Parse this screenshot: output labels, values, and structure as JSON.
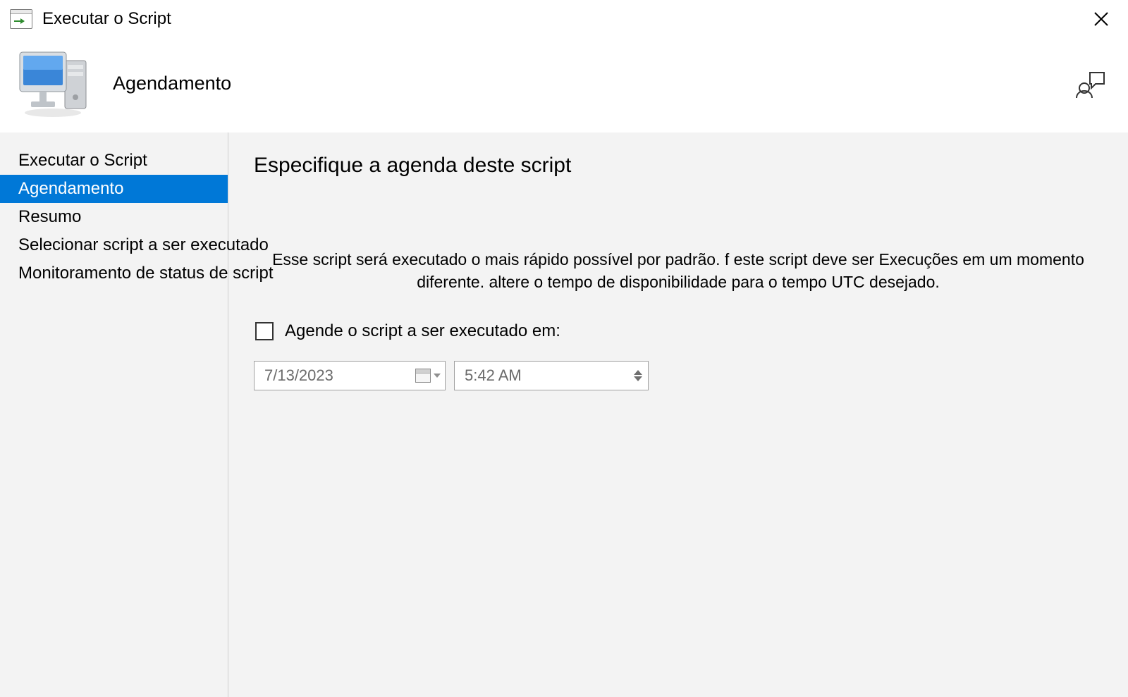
{
  "window": {
    "title": "Executar o Script"
  },
  "header": {
    "page_title": "Agendamento"
  },
  "sidebar": {
    "items": [
      {
        "label": "Executar o Script",
        "selected": false
      },
      {
        "label": "Agendamento",
        "selected": true
      },
      {
        "label": "Resumo",
        "selected": false
      },
      {
        "label": "Selecionar script a ser executado",
        "selected": false
      },
      {
        "label": "Monitoramento de status de script",
        "selected": false
      }
    ]
  },
  "content": {
    "heading": "Especifique a agenda deste script",
    "description": "Esse script será executado o mais rápido possível por padrão. f este script deve ser Execuções em um momento diferente. altere o tempo de disponibilidade para o tempo UTC desejado.",
    "checkbox_label": "Agende o script a ser executado em:",
    "checkbox_checked": false,
    "date_value": "7/13/2023",
    "time_value": "5:42 AM"
  }
}
